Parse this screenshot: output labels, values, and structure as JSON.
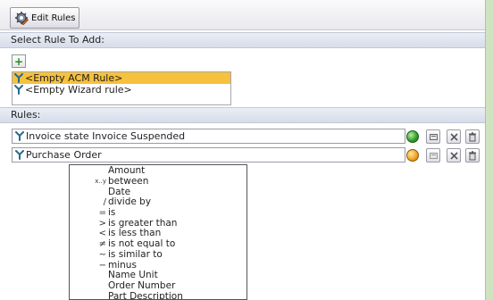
{
  "toolbar": {
    "edit_rules_label": "Edit Rules"
  },
  "select_section": {
    "title": "Select Rule To Add:",
    "add_label": "+"
  },
  "rule_options": [
    {
      "label": "<Empty ACM Rule>",
      "selected": true
    },
    {
      "label": "<Empty Wizard rule>",
      "selected": false
    }
  ],
  "rules_section": {
    "title": "Rules:"
  },
  "rules": [
    {
      "label": "Invoice state Invoice Suspended",
      "status": "green"
    },
    {
      "label": "Purchase Order",
      "status": "orange"
    }
  ],
  "dropdown": {
    "items": [
      {
        "symbol": "",
        "label": "Amount"
      },
      {
        "symbol": "x..y",
        "label": "between"
      },
      {
        "symbol": "",
        "label": "Date"
      },
      {
        "symbol": "/",
        "label": "divide by"
      },
      {
        "symbol": "=",
        "label": "is"
      },
      {
        "symbol": ">",
        "label": "is greater than"
      },
      {
        "symbol": "<",
        "label": "is less than"
      },
      {
        "symbol": "≠",
        "label": "is not equal to"
      },
      {
        "symbol": "~",
        "label": "is similar to"
      },
      {
        "symbol": "−",
        "label": "minus"
      },
      {
        "symbol": "",
        "label": "Name Unit"
      },
      {
        "symbol": "",
        "label": "Order Number"
      },
      {
        "symbol": "",
        "label": "Part Description"
      }
    ]
  },
  "colors": {
    "selection": "#f6c13c",
    "status_ok": "#2f9a2a",
    "status_warn": "#f0a020",
    "panel_border": "#cfe3c0"
  }
}
